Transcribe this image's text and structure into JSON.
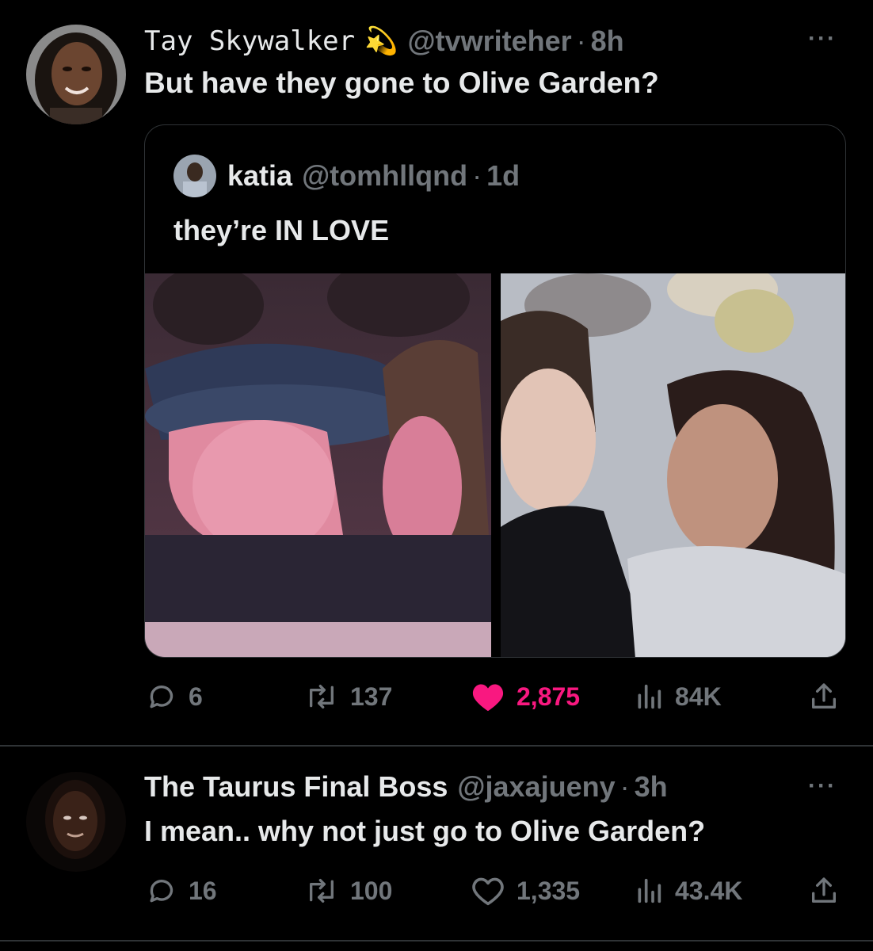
{
  "tweet1": {
    "display_name": "Tay Skywalker",
    "badge_emoji": "💫",
    "handle": "@tvwriteher",
    "separator": "·",
    "time": "8h",
    "text": "But have they gone to Olive Garden?",
    "more": "···",
    "quote": {
      "display_name": "katia",
      "handle": "@tomhllqnd",
      "separator": "·",
      "time": "1d",
      "text": "they’re IN LOVE"
    },
    "stats": {
      "replies": "6",
      "retweets": "137",
      "likes": "2,875",
      "views": "84K"
    },
    "like_color": "#f91880"
  },
  "tweet2": {
    "display_name": "The Taurus Final Boss",
    "handle": "@jaxajueny",
    "separator": "·",
    "time": "3h",
    "text": "I mean.. why not just go to Olive Garden?",
    "more": "···",
    "stats": {
      "replies": "16",
      "retweets": "100",
      "likes": "1,335",
      "views": "43.4K"
    }
  },
  "icons": {
    "reply": "reply-icon",
    "retweet": "retweet-icon",
    "like": "heart-icon",
    "views": "views-icon",
    "share": "share-icon",
    "more": "more-icon"
  },
  "colors": {
    "background": "#000000",
    "text": "#e7e9ea",
    "secondary": "#71767b",
    "border": "#2f3336",
    "like": "#f91880"
  }
}
